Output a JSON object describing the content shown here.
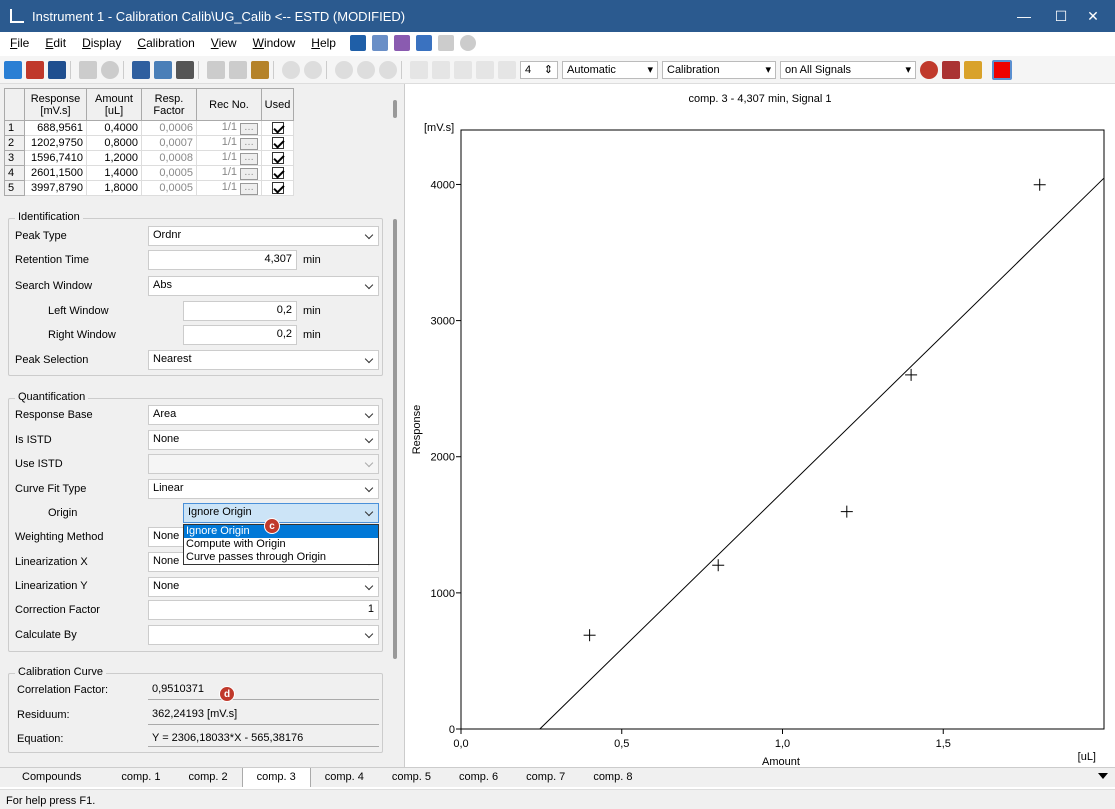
{
  "window": {
    "title": "Instrument 1 - Calibration Calib\\UG_Calib <-- ESTD (MODIFIED)"
  },
  "menu": [
    {
      "u": "F",
      "rest": "ile"
    },
    {
      "u": "E",
      "rest": "dit"
    },
    {
      "u": "D",
      "rest": "isplay"
    },
    {
      "u": "C",
      "rest": "alibration"
    },
    {
      "u": "V",
      "rest": "iew"
    },
    {
      "u": "W",
      "rest": "indow"
    },
    {
      "u": "H",
      "rest": "elp"
    }
  ],
  "toolbar": {
    "spin_value": "4",
    "mode": "Automatic",
    "view": "Calibration",
    "signals": "on All Signals"
  },
  "table": {
    "headers": [
      "Response\n[mV.s]",
      "Amount\n[uL]",
      "Resp.\nFactor",
      "Rec No.",
      "Used"
    ],
    "rows": [
      {
        "n": "1",
        "response": "688,9561",
        "amount": "0,4000",
        "factor": "0,0006",
        "rec": "1/1"
      },
      {
        "n": "2",
        "response": "1202,9750",
        "amount": "0,8000",
        "factor": "0,0007",
        "rec": "1/1"
      },
      {
        "n": "3",
        "response": "1596,7410",
        "amount": "1,2000",
        "factor": "0,0008",
        "rec": "1/1"
      },
      {
        "n": "4",
        "response": "2601,1500",
        "amount": "1,4000",
        "factor": "0,0005",
        "rec": "1/1"
      },
      {
        "n": "5",
        "response": "3997,8790",
        "amount": "1,8000",
        "factor": "0,0005",
        "rec": "1/1"
      }
    ]
  },
  "identification": {
    "title": "Identification",
    "peak_type_label": "Peak Type",
    "peak_type": "Ordnr",
    "rt_label": "Retention Time",
    "rt": "4,307",
    "rt_unit": "min",
    "search_label": "Search Window",
    "search": "Abs",
    "left_label": "Left Window",
    "left": "0,2",
    "left_unit": "min",
    "right_label": "Right Window",
    "right": "0,2",
    "right_unit": "min",
    "selection_label": "Peak Selection",
    "selection": "Nearest"
  },
  "quantification": {
    "title": "Quantification",
    "base_label": "Response Base",
    "base": "Area",
    "istd_label": "Is ISTD",
    "istd": "None",
    "use_istd_label": "Use ISTD",
    "use_istd": "",
    "fit_label": "Curve Fit Type",
    "fit": "Linear",
    "origin_label": "Origin",
    "origin": "Ignore Origin",
    "origin_options": [
      "Ignore Origin",
      "Compute with Origin",
      "Curve passes through Origin"
    ],
    "weight_label": "Weighting Method",
    "weight": "None",
    "linx_label": "Linearization X",
    "linx": "None",
    "liny_label": "Linearization Y",
    "liny": "None",
    "cf_label": "Correction Factor",
    "cf": "1",
    "calc_label": "Calculate By",
    "calc": ""
  },
  "curve": {
    "title": "Calibration Curve",
    "corr_label": "Correlation Factor:",
    "corr": "0,9510371",
    "res_label": "Residuum:",
    "res": "362,24193 [mV.s]",
    "eq_label": "Equation:",
    "eq": "Y = 2306,18033*X - 565,38176"
  },
  "badges": {
    "c": "c",
    "d": "d"
  },
  "chart_data": {
    "type": "scatter",
    "title": "comp. 3 - 4,307 min, Signal 1",
    "xlabel": "Amount",
    "ylabel": "Response",
    "xunit": "[uL]",
    "yunit": "[mV.s]",
    "xlim": [
      0,
      2.0
    ],
    "ylim": [
      0,
      4400
    ],
    "xticks": [
      {
        "v": 0,
        "label": "0,0"
      },
      {
        "v": 0.5,
        "label": "0,5"
      },
      {
        "v": 1.0,
        "label": "1,0"
      },
      {
        "v": 1.5,
        "label": "1,5"
      }
    ],
    "yticks": [
      {
        "v": 0,
        "label": "0"
      },
      {
        "v": 1000,
        "label": "1000"
      },
      {
        "v": 2000,
        "label": "2000"
      },
      {
        "v": 3000,
        "label": "3000"
      },
      {
        "v": 4000,
        "label": "4000"
      }
    ],
    "points": [
      [
        0.4,
        688.9561
      ],
      [
        0.8,
        1202.975
      ],
      [
        1.2,
        1596.741
      ],
      [
        1.4,
        2601.15
      ],
      [
        1.8,
        3997.879
      ]
    ],
    "fit": {
      "slope": 2306.18033,
      "intercept": -565.38176
    }
  },
  "tabs": [
    "Compounds",
    "comp. 1",
    "comp. 2",
    "comp. 3",
    "comp. 4",
    "comp. 5",
    "comp. 6",
    "comp. 7",
    "comp. 8"
  ],
  "selected_tab": 3,
  "status": "For help press F1."
}
